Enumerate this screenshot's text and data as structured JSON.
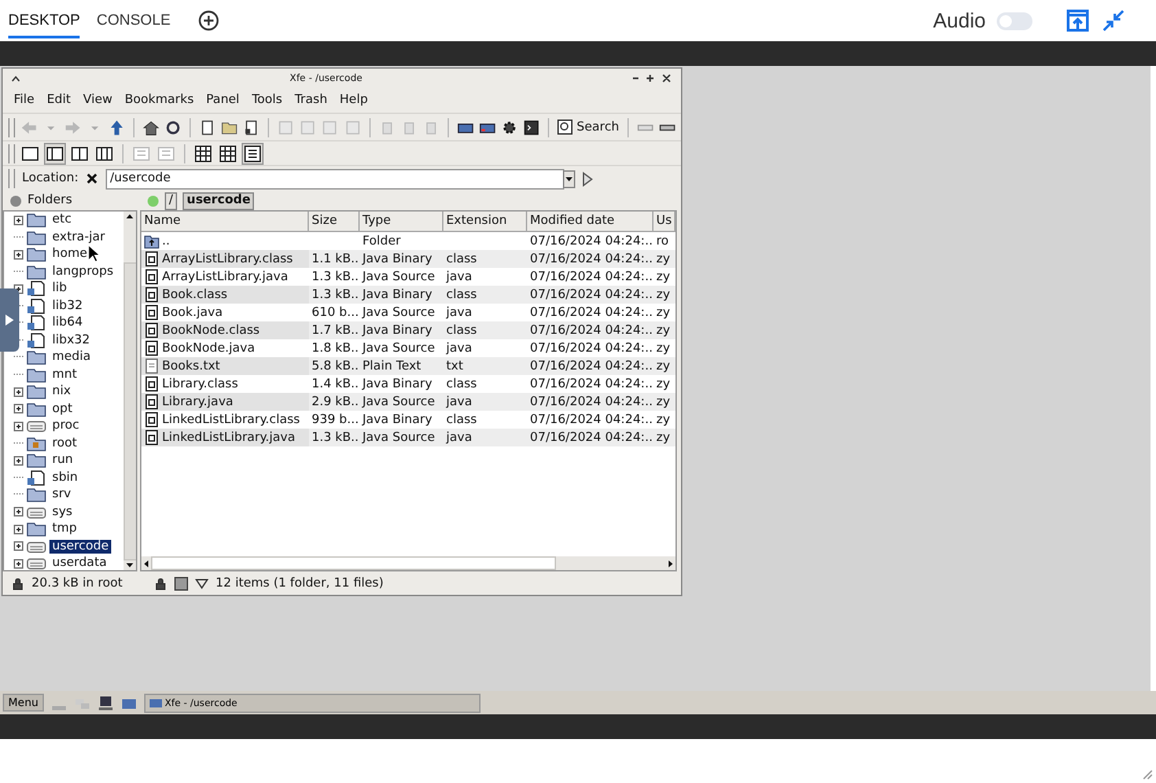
{
  "top_bar": {
    "tabs": [
      {
        "label": "DESKTOP",
        "selected": true
      },
      {
        "label": "CONSOLE",
        "selected": false
      }
    ],
    "audio_label": "Audio",
    "audio_on": false
  },
  "window": {
    "title": "Xfe - /usercode",
    "menu": [
      "File",
      "Edit",
      "View",
      "Bookmarks",
      "Panel",
      "Tools",
      "Trash",
      "Help"
    ],
    "search_label": "Search",
    "location_label": "Location:",
    "location_value": "/usercode",
    "folders_header": "Folders",
    "tree": [
      {
        "label": "etc",
        "kind": "folder",
        "expandable": true,
        "selected": false
      },
      {
        "label": "extra-jar",
        "kind": "folder",
        "expandable": false,
        "selected": false
      },
      {
        "label": "home",
        "kind": "folder",
        "expandable": true,
        "selected": false
      },
      {
        "label": "langprops",
        "kind": "folder",
        "expandable": false,
        "selected": false
      },
      {
        "label": "lib",
        "kind": "link",
        "expandable": true,
        "selected": false
      },
      {
        "label": "lib32",
        "kind": "link",
        "expandable": false,
        "selected": false
      },
      {
        "label": "lib64",
        "kind": "link",
        "expandable": false,
        "selected": false
      },
      {
        "label": "libx32",
        "kind": "link",
        "expandable": false,
        "selected": false
      },
      {
        "label": "media",
        "kind": "folder",
        "expandable": false,
        "selected": false
      },
      {
        "label": "mnt",
        "kind": "folder",
        "expandable": false,
        "selected": false
      },
      {
        "label": "nix",
        "kind": "folder",
        "expandable": true,
        "selected": false
      },
      {
        "label": "opt",
        "kind": "folder",
        "expandable": true,
        "selected": false
      },
      {
        "label": "proc",
        "kind": "drive",
        "expandable": true,
        "selected": false
      },
      {
        "label": "root",
        "kind": "locked",
        "expandable": false,
        "selected": false
      },
      {
        "label": "run",
        "kind": "folder",
        "expandable": true,
        "selected": false
      },
      {
        "label": "sbin",
        "kind": "link",
        "expandable": false,
        "selected": false
      },
      {
        "label": "srv",
        "kind": "folder",
        "expandable": false,
        "selected": false
      },
      {
        "label": "sys",
        "kind": "drive",
        "expandable": true,
        "selected": false
      },
      {
        "label": "tmp",
        "kind": "folder",
        "expandable": true,
        "selected": false
      },
      {
        "label": "usercode",
        "kind": "drive",
        "expandable": true,
        "selected": true
      },
      {
        "label": "userdata",
        "kind": "drive",
        "expandable": true,
        "selected": false
      }
    ],
    "breadcrumb": [
      {
        "label": "/",
        "selected": false
      },
      {
        "label": "usercode",
        "selected": true
      }
    ],
    "columns": [
      "Name",
      "Size",
      "Type",
      "Extension",
      "Modified date",
      "Us"
    ],
    "rows": [
      {
        "kind": "folder",
        "name": "..",
        "size": "",
        "type": "Folder",
        "extension": "",
        "modified": "07/16/2024 04:24:...",
        "user": "ro"
      },
      {
        "kind": "file",
        "name": "ArrayListLibrary.class",
        "size": "1.1 kB...",
        "type": "Java Binary",
        "extension": "class",
        "modified": "07/16/2024 04:24:...",
        "user": "zy"
      },
      {
        "kind": "file",
        "name": "ArrayListLibrary.java",
        "size": "1.3 kB...",
        "type": "Java Source",
        "extension": "java",
        "modified": "07/16/2024 04:24:...",
        "user": "zy"
      },
      {
        "kind": "file",
        "name": "Book.class",
        "size": "1.3 kB...",
        "type": "Java Binary",
        "extension": "class",
        "modified": "07/16/2024 04:24:...",
        "user": "zy"
      },
      {
        "kind": "file",
        "name": "Book.java",
        "size": "610 b...",
        "type": "Java Source",
        "extension": "java",
        "modified": "07/16/2024 04:24:...",
        "user": "zy"
      },
      {
        "kind": "file",
        "name": "BookNode.class",
        "size": "1.7 kB...",
        "type": "Java Binary",
        "extension": "class",
        "modified": "07/16/2024 04:24:...",
        "user": "zy"
      },
      {
        "kind": "file",
        "name": "BookNode.java",
        "size": "1.8 kB...",
        "type": "Java Source",
        "extension": "java",
        "modified": "07/16/2024 04:24:...",
        "user": "zy"
      },
      {
        "kind": "text",
        "name": "Books.txt",
        "size": "5.8 kB...",
        "type": "Plain Text",
        "extension": "txt",
        "modified": "07/16/2024 04:24:...",
        "user": "zy"
      },
      {
        "kind": "file",
        "name": "Library.class",
        "size": "1.4 kB...",
        "type": "Java Binary",
        "extension": "class",
        "modified": "07/16/2024 04:24:...",
        "user": "zy"
      },
      {
        "kind": "file",
        "name": "Library.java",
        "size": "2.9 kB...",
        "type": "Java Source",
        "extension": "java",
        "modified": "07/16/2024 04:24:...",
        "user": "zy"
      },
      {
        "kind": "file",
        "name": "LinkedListLibrary.class",
        "size": "939 b...",
        "type": "Java Binary",
        "extension": "class",
        "modified": "07/16/2024 04:24:...",
        "user": "zy"
      },
      {
        "kind": "file",
        "name": "LinkedListLibrary.java",
        "size": "1.3 kB...",
        "type": "Java Source",
        "extension": "java",
        "modified": "07/16/2024 04:24:...",
        "user": "zy"
      }
    ],
    "status_left": "20.3 kB in root",
    "status_right": "12 items (1 folder, 11 files)"
  },
  "taskbar": {
    "menu_label": "Menu",
    "task_label": "Xfe - /usercode"
  }
}
